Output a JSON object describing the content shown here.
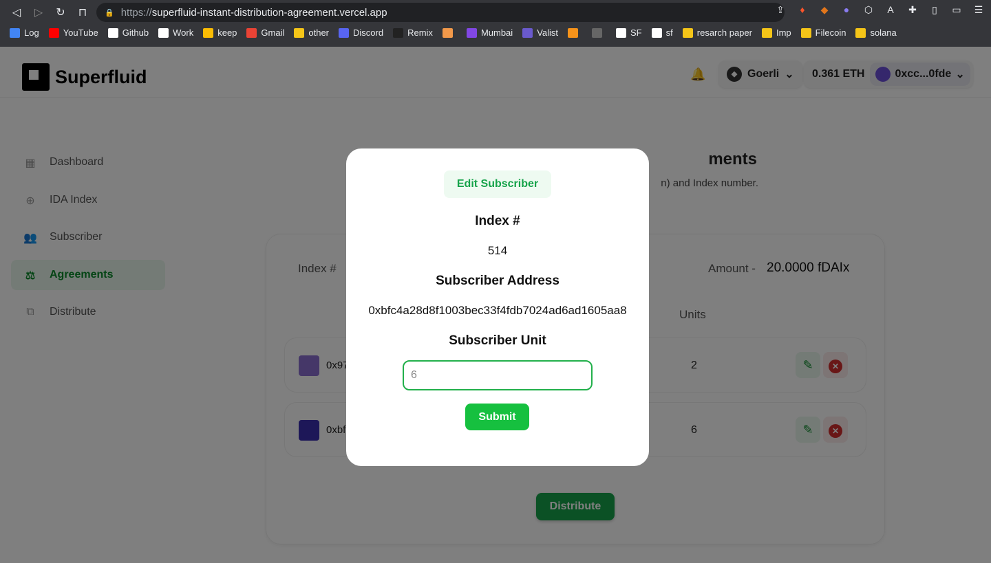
{
  "browser": {
    "url_proto": "https://",
    "url_host": "superfluid-instant-distribution-agreement.vercel.app",
    "bookmarks": [
      "Log",
      "YouTube",
      "Github",
      "Work",
      "keep",
      "Gmail",
      "other",
      "Discord",
      "Remix",
      "",
      "Mumbai",
      "Valist",
      "",
      "",
      "SF",
      "sf",
      "resarch paper",
      "Imp",
      "Filecoin",
      "solana"
    ]
  },
  "header": {
    "brand": "Superfluid",
    "network": "Goerli",
    "balance": "0.361 ETH",
    "account": "0xcc...0fde"
  },
  "sidebar": {
    "items": [
      {
        "label": "Dashboard",
        "icon": "dashboard-icon"
      },
      {
        "label": "IDA Index",
        "icon": "plus-circle-icon"
      },
      {
        "label": "Subscriber",
        "icon": "users-icon"
      },
      {
        "label": "Agreements",
        "icon": "gavel-icon"
      },
      {
        "label": "Distribute",
        "icon": "tree-icon"
      }
    ]
  },
  "main": {
    "title_partial": "ments",
    "subtitle_partial": "n) and Index number.",
    "index_label": "Index #",
    "amount_label": "Amount -",
    "amount_value": "20.0000 fDAIx",
    "units_header": "Units",
    "rows": [
      {
        "address": "0x97",
        "units": "2"
      },
      {
        "address": "0xbf",
        "units": "6"
      }
    ],
    "distribute": "Distribute"
  },
  "modal": {
    "title": "Edit Subscriber",
    "index_label": "Index #",
    "index_value": "514",
    "address_label": "Subscriber Address",
    "address_value": "0xbfc4a28d8f1003bec33f4fdb7024ad6ad1605aa8",
    "unit_label": "Subscriber Unit",
    "unit_placeholder": "6",
    "submit": "Submit"
  },
  "colors": {
    "accent": "#16a34a",
    "danger": "#d32f2f"
  }
}
